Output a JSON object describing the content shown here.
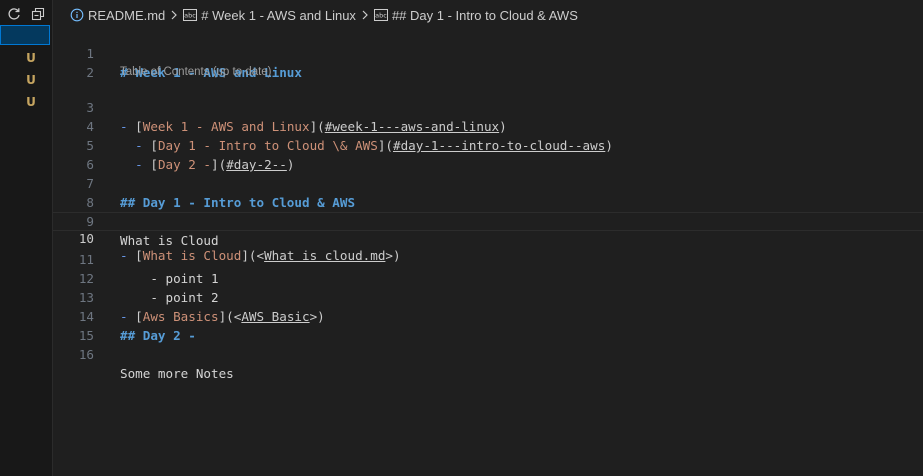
{
  "breadcrumb": {
    "file": "README.md",
    "section1": "# Week 1 - AWS and Linux",
    "section2": "## Day 1 - Intro to Cloud & AWS"
  },
  "sidebar": {
    "status_badges": [
      "U",
      "U",
      "U"
    ]
  },
  "editor": {
    "codelens": "Table of Contents (up to date)",
    "current_line": 10,
    "line_numbers": [
      "1",
      "2",
      "3",
      "4",
      "5",
      "6",
      "7",
      "8",
      "9",
      "10",
      "11",
      "12",
      "13",
      "14",
      "15",
      "16"
    ],
    "lines": {
      "l1": "# Week 1 - AWS and Linux",
      "l3_dash": "- ",
      "l3_text": "Week 1 - AWS and Linux",
      "l3_link": "#week-1---aws-and-linux",
      "l4_dash": "  - ",
      "l4_text": "Day 1 - Intro to Cloud \\& AWS",
      "l4_link": "#day-1---intro-to-cloud--aws",
      "l5_dash": "  - ",
      "l5_text": "Day 2 -",
      "l5_link": "#day-2--",
      "l7": "## Day 1 - Intro to Cloud & AWS",
      "l9": "What is Cloud",
      "l10_dash": "- ",
      "l10_text": "What is Cloud",
      "l10_link": "What is cloud.md",
      "l11": "    - point 1",
      "l12": "    - point 2",
      "l13_dash": "- ",
      "l13_text": "Aws Basics",
      "l13_link": "AWS Basic",
      "l14": "## Day 2 -",
      "l16": "Some more Notes"
    }
  },
  "colors": {
    "background": "#1f1f1f",
    "heading": "#569cd6",
    "link_text": "#ce9178",
    "selection": "#04395e",
    "git_untracked": "#c6a560"
  }
}
